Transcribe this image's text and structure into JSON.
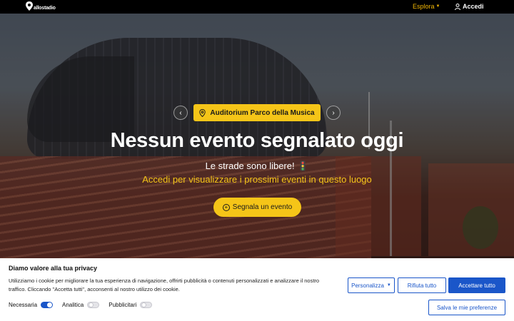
{
  "header": {
    "brand": "allostadio",
    "explore_label": "Esplora",
    "login_label": "Accedi"
  },
  "hero": {
    "venue_label": "Auditorium Parco della Musica",
    "headline": "Nessun evento segnalato oggi",
    "subline": "Le strade sono libere! 🚦",
    "login_prompt": "Accedi per visualizzare i prossimi eventi in questo luogo",
    "report_button": "Segnala un evento",
    "prev_icon": "chevron-left-icon",
    "next_icon": "chevron-right-icon"
  },
  "cookie_banner": {
    "title": "Diamo valore alla tua privacy",
    "text": "Utilizziamo i cookie per migliorare la tua esperienza di navigazione, offrirti pubblicità o contenuti personalizzati e analizzare il nostro traffico. Cliccando \"Accetta tutti\", acconsenti al nostro utilizzo dei cookie.",
    "toggles": [
      {
        "label": "Necessaria",
        "on": true
      },
      {
        "label": "Analitica",
        "on": false
      },
      {
        "label": "Pubblicitari",
        "on": false
      }
    ],
    "customize_label": "Personalizza",
    "reject_label": "Rifiuta tutto",
    "accept_label": "Accettare tutto",
    "save_label": "Salva le mie preferenze"
  },
  "colors": {
    "accent_yellow": "#f5c518",
    "primary_blue": "#1a56c9",
    "nav_bg": "#000000"
  }
}
